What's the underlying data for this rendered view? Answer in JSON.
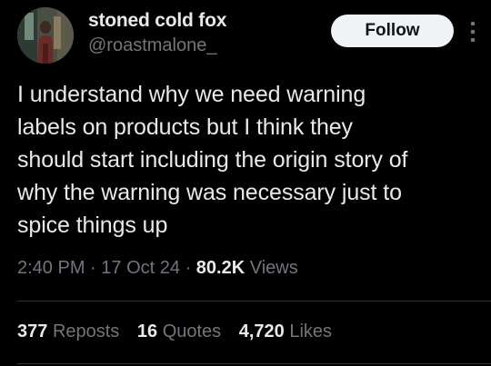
{
  "user": {
    "display_name": "stoned cold fox",
    "handle": "@roastmalone_",
    "avatar_icon": "profile-photo"
  },
  "actions": {
    "follow_label": "Follow",
    "more_icon": "vertical-ellipsis-icon"
  },
  "tweet": {
    "lines": [
      "I understand why we need warning",
      "labels on products but I think they",
      "should start including the origin story of",
      "why the warning was necessary just to",
      "spice things up"
    ]
  },
  "meta": {
    "time": "2:40 PM",
    "separator": "·",
    "date": "17 Oct 24",
    "views_count": "80.2K",
    "views_label": "Views"
  },
  "stats": {
    "reposts_count": "377",
    "reposts_label": "Reposts",
    "quotes_count": "16",
    "quotes_label": "Quotes",
    "likes_count": "4,720",
    "likes_label": "Likes"
  },
  "colors": {
    "background": "#000000",
    "primary_text": "#e7e9ea",
    "secondary_text": "#71767b",
    "follow_bg": "#eff3f4",
    "divider": "#2f3336"
  }
}
